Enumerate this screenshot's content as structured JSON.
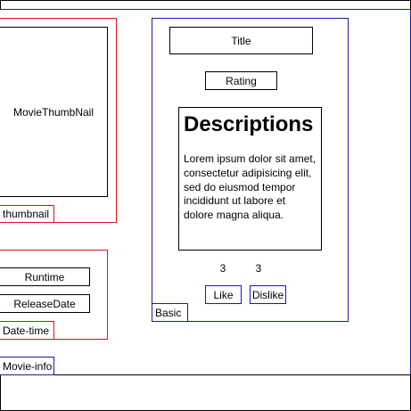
{
  "thumbnail": {
    "placeholder": "MovieThumbNail",
    "tag": "thumbnail"
  },
  "date_time": {
    "runtime": "Runtime",
    "release_date": "ReleaseDate",
    "tag": "Date-time"
  },
  "basic": {
    "title": "Title",
    "rating": "Rating",
    "description_heading": "Descriptions",
    "description_body": "Lorem ipsum dolor sit amet, consectetur adipisicing elit, sed do eiusmod tempor incididunt ut labore et dolore magna aliqua.",
    "like_count": "3",
    "dislike_count": "3",
    "like_label": "Like",
    "dislike_label": "Dislike",
    "tag": "Basic"
  },
  "movie_info": {
    "tag": "Movie-info"
  },
  "colors": {
    "container_border": "#1a1aa6",
    "group_border": "#d11a1a",
    "box_border": "#000000"
  }
}
